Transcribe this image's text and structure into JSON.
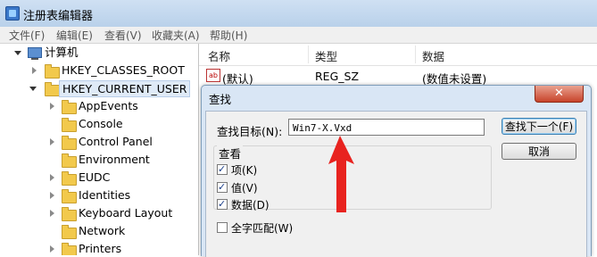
{
  "window": {
    "title": "注册表编辑器"
  },
  "menu": [
    "文件(F)",
    "编辑(E)",
    "查看(V)",
    "收藏夹(A)",
    "帮助(H)"
  ],
  "tree": {
    "root": "计算机",
    "hives": [
      "HKEY_CLASSES_ROOT",
      "HKEY_CURRENT_USER"
    ],
    "subkeys": [
      "AppEvents",
      "Console",
      "Control Panel",
      "Environment",
      "EUDC",
      "Identities",
      "Keyboard Layout",
      "Network",
      "Printers"
    ]
  },
  "list": {
    "headers": {
      "name": "名称",
      "type": "类型",
      "data": "数据"
    },
    "rows": [
      {
        "name": "(默认)",
        "type": "REG_SZ",
        "data": "(数值未设置)",
        "icon": "ab-string-icon"
      }
    ]
  },
  "dialog": {
    "title": "查找",
    "close_glyph": "✕",
    "find_label": "查找目标(N):",
    "find_value": "Win7-X.Vxd",
    "find_next_label": "查找下一个(F)",
    "cancel_label": "取消",
    "lookat_title": "查看",
    "opt_keys": "项(K)",
    "opt_values": "值(V)",
    "opt_data": "数据(D)",
    "match_whole": "全字匹配(W)"
  },
  "colors": {
    "annotation_arrow": "#e8231f",
    "accent": "#3c7fb1"
  }
}
